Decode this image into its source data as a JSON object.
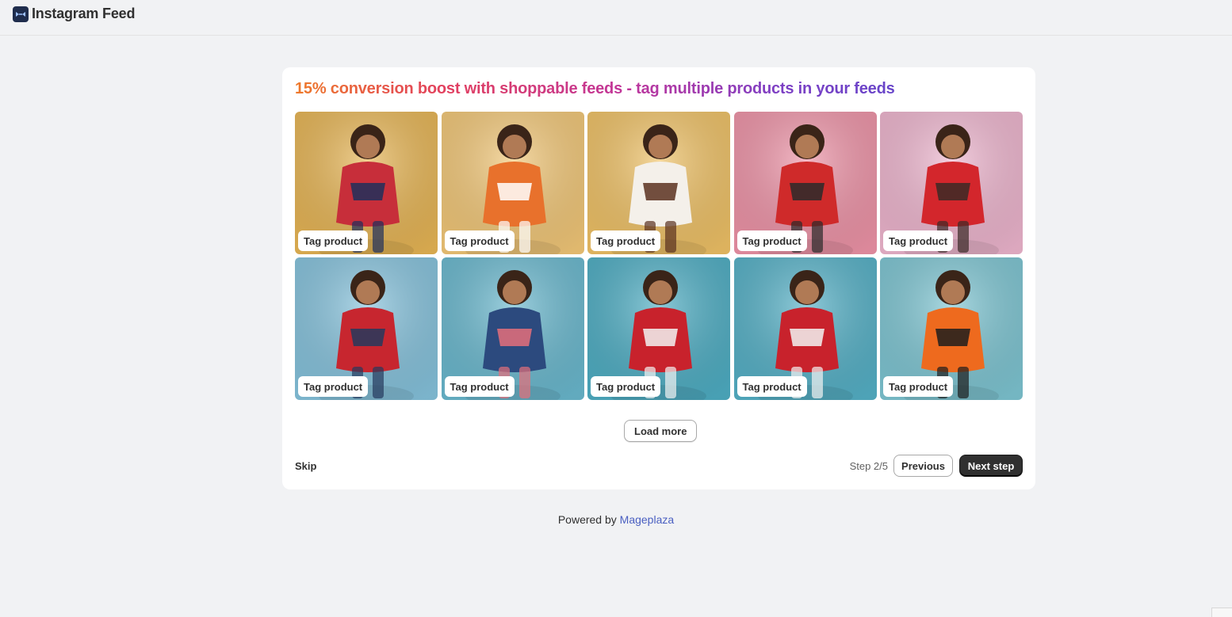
{
  "app": {
    "title": "Instagram Feed",
    "logo_icon": "app-logo-icon"
  },
  "headline": "15% conversion boost with shoppable feeds - tag multiple products in your feeds",
  "feed": {
    "tag_label": "Tag product",
    "tiles": [
      {
        "bg": "#e8b655",
        "fg": "#c72e3a",
        "accent": "#1e2f5c"
      },
      {
        "bg": "#f3c878",
        "fg": "#e8712c",
        "accent": "#ffffff"
      },
      {
        "bg": "#f0c266",
        "fg": "#f4f0ea",
        "accent": "#5a3120"
      },
      {
        "bg": "#ef94a8",
        "fg": "#cf2a2a",
        "accent": "#2a2a2a"
      },
      {
        "bg": "#efb6cf",
        "fg": "#d3262c",
        "accent": "#3a2a26"
      },
      {
        "bg": "#86c3dd",
        "fg": "#c7262f",
        "accent": "#25395d"
      },
      {
        "bg": "#6ab9cf",
        "fg": "#2c4a7e",
        "accent": "#e56f7a"
      },
      {
        "bg": "#4eaec4",
        "fg": "#c8222c",
        "accent": "#f2f2f2"
      },
      {
        "bg": "#55b1c7",
        "fg": "#c8222c",
        "accent": "#f2f2f2"
      },
      {
        "bg": "#7ec6d3",
        "fg": "#ee6a1e",
        "accent": "#1d1d1d"
      }
    ]
  },
  "actions": {
    "load_more": "Load more",
    "skip": "Skip",
    "step": "Step 2/5",
    "previous": "Previous",
    "next": "Next step"
  },
  "footer": {
    "powered_by": "Powered by",
    "brand": "Mageplaza"
  }
}
